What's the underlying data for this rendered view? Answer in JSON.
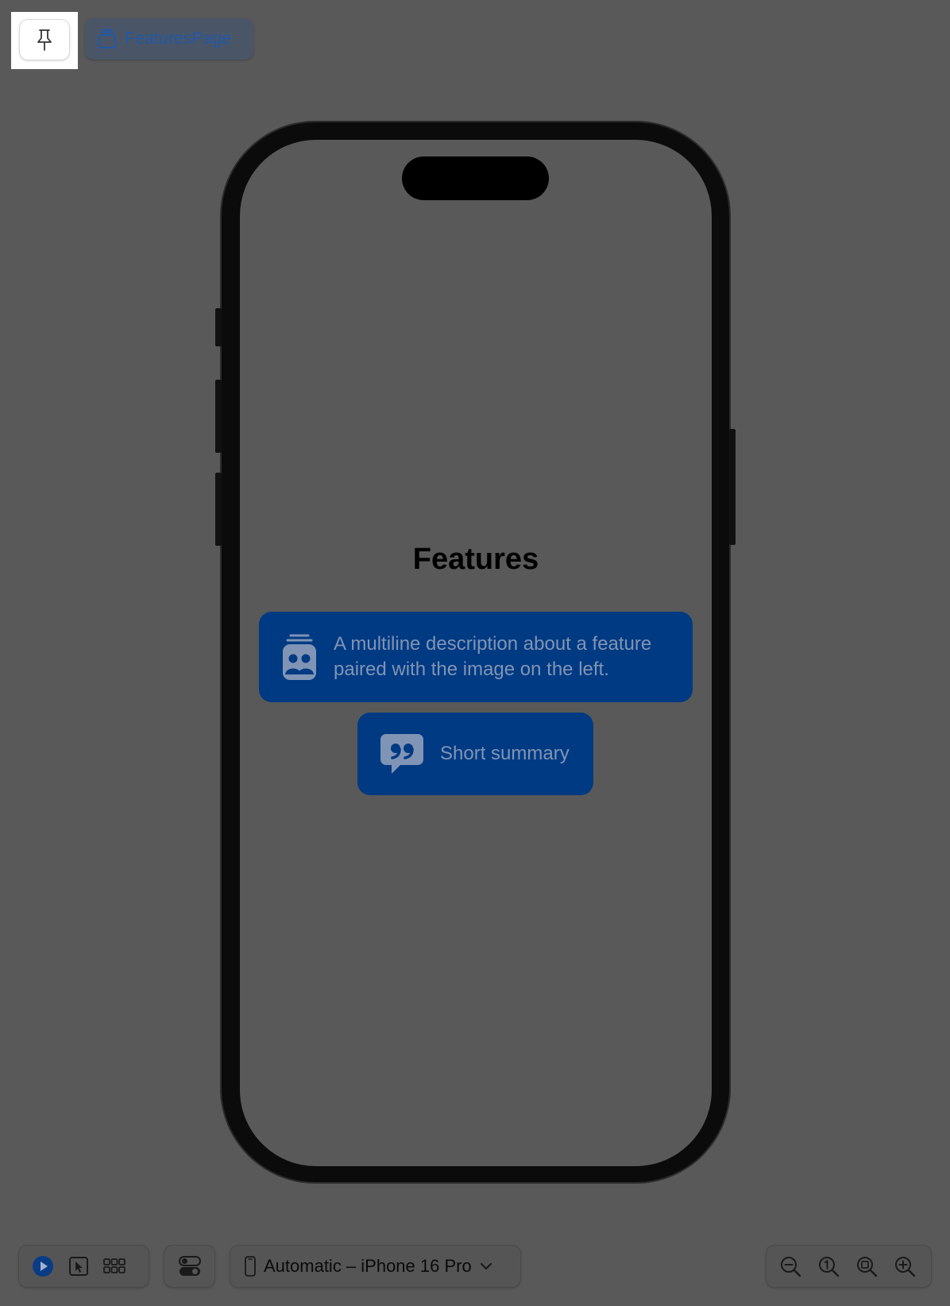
{
  "toolbar_top": {
    "pin_icon": "pin-icon",
    "preview_chip": {
      "icon": "stack-icon",
      "label": "FeaturesPage"
    }
  },
  "preview": {
    "title": "Features",
    "features": [
      {
        "icon": "person-2-badge-icon",
        "text": "A multiline description about a feature paired with the image on the left."
      },
      {
        "icon": "quote-bubble-icon",
        "text": "Short summary"
      }
    ],
    "accent_color": "#003a82"
  },
  "toolbar_bottom": {
    "modes": [
      "play-icon",
      "cursor-select-icon",
      "grid-variants-icon"
    ],
    "settings_icon": "toggle-settings-icon",
    "device_selector": {
      "icon": "iphone-icon",
      "label": "Automatic – iPhone 16 Pro",
      "chevron": "chevron-down-icon"
    },
    "zoom": [
      "zoom-out-icon",
      "zoom-actual-size-icon",
      "zoom-to-fit-icon",
      "zoom-in-icon"
    ]
  }
}
